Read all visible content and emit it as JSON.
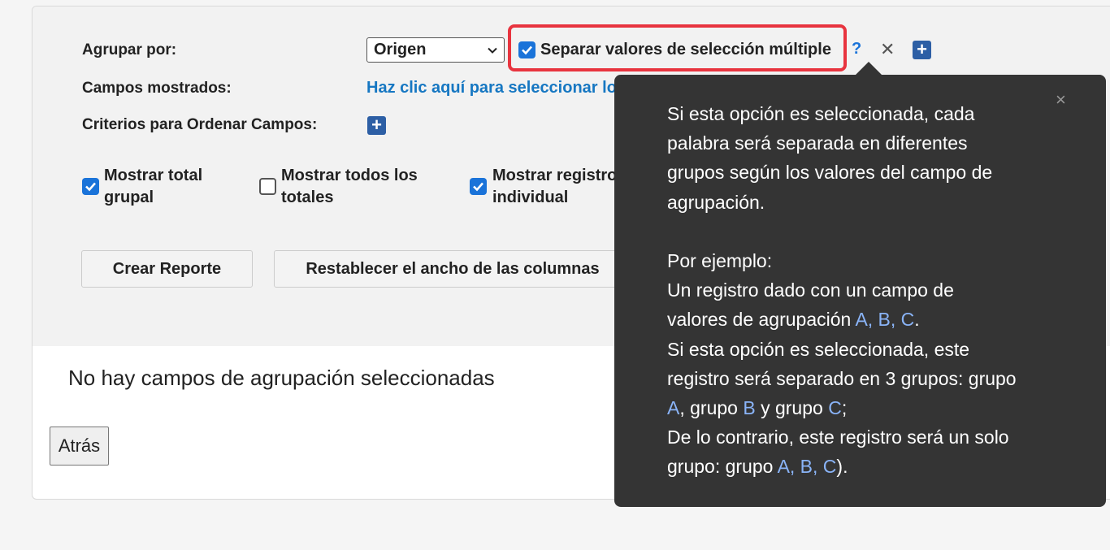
{
  "form": {
    "group_by_label": "Agrupar por:",
    "group_by_value": "Origen",
    "separate_label": "Separar valores de selección múltiple",
    "help": "?",
    "remove": "✕",
    "add": "+",
    "shown_fields_label": "Campos mostrados:",
    "shown_fields_link": "Haz clic aquí para seleccionar los campos",
    "sort_label": "Criterios para Ordenar Campos:"
  },
  "options": [
    {
      "line1": "Mostrar total",
      "line2": "grupal",
      "checked": true
    },
    {
      "line1": "Mostrar todos los",
      "line2": "totales",
      "checked": false
    },
    {
      "line1": "Mostrar registro",
      "line2": "individual",
      "checked": true
    }
  ],
  "buttons": {
    "create": "Crear Reporte",
    "reset": "Restablecer el ancho de las columnas"
  },
  "results": {
    "empty_message": "No hay campos de agrupación seleccionadas",
    "back": "Atrás"
  },
  "tooltip": {
    "close": "×",
    "lines": [
      {
        "parts": [
          {
            "t": "Si esta opción es seleccionada, cada"
          }
        ]
      },
      {
        "parts": [
          {
            "t": "palabra será separada en diferentes"
          }
        ]
      },
      {
        "parts": [
          {
            "t": "grupos según los valores del campo de"
          }
        ]
      },
      {
        "parts": [
          {
            "t": "agrupación."
          }
        ]
      },
      {
        "parts": [
          {
            "t": ""
          }
        ]
      },
      {
        "parts": [
          {
            "t": "Por ejemplo:"
          }
        ]
      },
      {
        "parts": [
          {
            "t": "Un registro dado con un campo de"
          }
        ]
      },
      {
        "parts": [
          {
            "t": "valores de agrupación "
          },
          {
            "t": "A, B, C",
            "hl": true
          },
          {
            "t": "."
          }
        ]
      },
      {
        "parts": [
          {
            "t": "Si esta opción es seleccionada, este"
          }
        ]
      },
      {
        "parts": [
          {
            "t": "registro será separado en 3 grupos: grupo"
          }
        ]
      },
      {
        "parts": [
          {
            "t": "A",
            "hl": true
          },
          {
            "t": ", grupo "
          },
          {
            "t": "B",
            "hl": true
          },
          {
            "t": " y grupo "
          },
          {
            "t": "C",
            "hl": true
          },
          {
            "t": ";"
          }
        ]
      },
      {
        "parts": [
          {
            "t": "De lo contrario, este registro será un solo"
          }
        ]
      },
      {
        "parts": [
          {
            "t": "grupo: grupo "
          },
          {
            "t": "A, B, C",
            "hl": true
          },
          {
            "t": ")."
          }
        ]
      }
    ]
  },
  "colors": {
    "accent": "#1a73d9",
    "highlight_border": "#e8343f",
    "tooltip_bg": "#343434",
    "tooltip_highlight": "#8ab4f8"
  }
}
